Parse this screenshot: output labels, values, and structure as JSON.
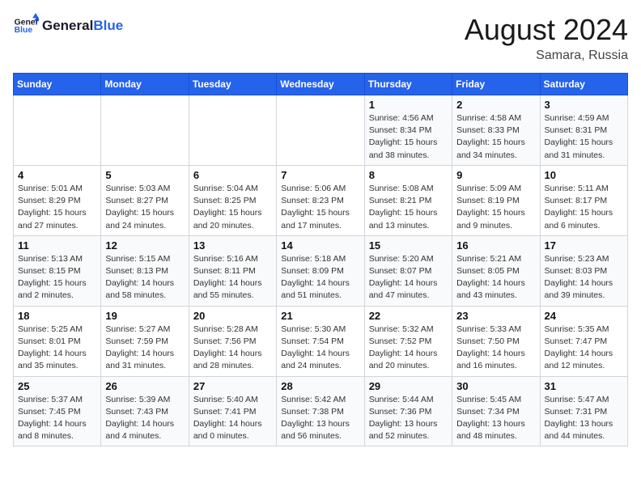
{
  "header": {
    "logo_line1": "General",
    "logo_line2": "Blue",
    "month_year": "August 2024",
    "location": "Samara, Russia"
  },
  "days_of_week": [
    "Sunday",
    "Monday",
    "Tuesday",
    "Wednesday",
    "Thursday",
    "Friday",
    "Saturday"
  ],
  "weeks": [
    [
      {
        "num": "",
        "detail": ""
      },
      {
        "num": "",
        "detail": ""
      },
      {
        "num": "",
        "detail": ""
      },
      {
        "num": "",
        "detail": ""
      },
      {
        "num": "1",
        "detail": "Sunrise: 4:56 AM\nSunset: 8:34 PM\nDaylight: 15 hours\nand 38 minutes."
      },
      {
        "num": "2",
        "detail": "Sunrise: 4:58 AM\nSunset: 8:33 PM\nDaylight: 15 hours\nand 34 minutes."
      },
      {
        "num": "3",
        "detail": "Sunrise: 4:59 AM\nSunset: 8:31 PM\nDaylight: 15 hours\nand 31 minutes."
      }
    ],
    [
      {
        "num": "4",
        "detail": "Sunrise: 5:01 AM\nSunset: 8:29 PM\nDaylight: 15 hours\nand 27 minutes."
      },
      {
        "num": "5",
        "detail": "Sunrise: 5:03 AM\nSunset: 8:27 PM\nDaylight: 15 hours\nand 24 minutes."
      },
      {
        "num": "6",
        "detail": "Sunrise: 5:04 AM\nSunset: 8:25 PM\nDaylight: 15 hours\nand 20 minutes."
      },
      {
        "num": "7",
        "detail": "Sunrise: 5:06 AM\nSunset: 8:23 PM\nDaylight: 15 hours\nand 17 minutes."
      },
      {
        "num": "8",
        "detail": "Sunrise: 5:08 AM\nSunset: 8:21 PM\nDaylight: 15 hours\nand 13 minutes."
      },
      {
        "num": "9",
        "detail": "Sunrise: 5:09 AM\nSunset: 8:19 PM\nDaylight: 15 hours\nand 9 minutes."
      },
      {
        "num": "10",
        "detail": "Sunrise: 5:11 AM\nSunset: 8:17 PM\nDaylight: 15 hours\nand 6 minutes."
      }
    ],
    [
      {
        "num": "11",
        "detail": "Sunrise: 5:13 AM\nSunset: 8:15 PM\nDaylight: 15 hours\nand 2 minutes."
      },
      {
        "num": "12",
        "detail": "Sunrise: 5:15 AM\nSunset: 8:13 PM\nDaylight: 14 hours\nand 58 minutes."
      },
      {
        "num": "13",
        "detail": "Sunrise: 5:16 AM\nSunset: 8:11 PM\nDaylight: 14 hours\nand 55 minutes."
      },
      {
        "num": "14",
        "detail": "Sunrise: 5:18 AM\nSunset: 8:09 PM\nDaylight: 14 hours\nand 51 minutes."
      },
      {
        "num": "15",
        "detail": "Sunrise: 5:20 AM\nSunset: 8:07 PM\nDaylight: 14 hours\nand 47 minutes."
      },
      {
        "num": "16",
        "detail": "Sunrise: 5:21 AM\nSunset: 8:05 PM\nDaylight: 14 hours\nand 43 minutes."
      },
      {
        "num": "17",
        "detail": "Sunrise: 5:23 AM\nSunset: 8:03 PM\nDaylight: 14 hours\nand 39 minutes."
      }
    ],
    [
      {
        "num": "18",
        "detail": "Sunrise: 5:25 AM\nSunset: 8:01 PM\nDaylight: 14 hours\nand 35 minutes."
      },
      {
        "num": "19",
        "detail": "Sunrise: 5:27 AM\nSunset: 7:59 PM\nDaylight: 14 hours\nand 31 minutes."
      },
      {
        "num": "20",
        "detail": "Sunrise: 5:28 AM\nSunset: 7:56 PM\nDaylight: 14 hours\nand 28 minutes."
      },
      {
        "num": "21",
        "detail": "Sunrise: 5:30 AM\nSunset: 7:54 PM\nDaylight: 14 hours\nand 24 minutes."
      },
      {
        "num": "22",
        "detail": "Sunrise: 5:32 AM\nSunset: 7:52 PM\nDaylight: 14 hours\nand 20 minutes."
      },
      {
        "num": "23",
        "detail": "Sunrise: 5:33 AM\nSunset: 7:50 PM\nDaylight: 14 hours\nand 16 minutes."
      },
      {
        "num": "24",
        "detail": "Sunrise: 5:35 AM\nSunset: 7:47 PM\nDaylight: 14 hours\nand 12 minutes."
      }
    ],
    [
      {
        "num": "25",
        "detail": "Sunrise: 5:37 AM\nSunset: 7:45 PM\nDaylight: 14 hours\nand 8 minutes."
      },
      {
        "num": "26",
        "detail": "Sunrise: 5:39 AM\nSunset: 7:43 PM\nDaylight: 14 hours\nand 4 minutes."
      },
      {
        "num": "27",
        "detail": "Sunrise: 5:40 AM\nSunset: 7:41 PM\nDaylight: 14 hours\nand 0 minutes."
      },
      {
        "num": "28",
        "detail": "Sunrise: 5:42 AM\nSunset: 7:38 PM\nDaylight: 13 hours\nand 56 minutes."
      },
      {
        "num": "29",
        "detail": "Sunrise: 5:44 AM\nSunset: 7:36 PM\nDaylight: 13 hours\nand 52 minutes."
      },
      {
        "num": "30",
        "detail": "Sunrise: 5:45 AM\nSunset: 7:34 PM\nDaylight: 13 hours\nand 48 minutes."
      },
      {
        "num": "31",
        "detail": "Sunrise: 5:47 AM\nSunset: 7:31 PM\nDaylight: 13 hours\nand 44 minutes."
      }
    ]
  ]
}
